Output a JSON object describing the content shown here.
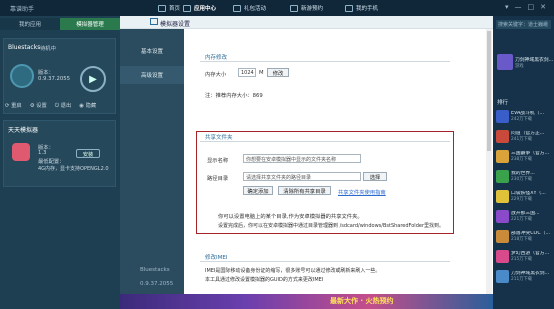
{
  "window": {
    "title": "靠谱助手"
  },
  "nav": [
    {
      "label": "首页"
    },
    {
      "label": "应用中心"
    },
    {
      "label": "礼包活动"
    },
    {
      "label": "新游预约"
    },
    {
      "label": "我的手机"
    }
  ],
  "window_controls": [
    "▾",
    "—",
    "□",
    "✕"
  ],
  "left_tabs": [
    {
      "label": "我的应用"
    },
    {
      "label": "模拟器管理"
    }
  ],
  "card1": {
    "name": "Bluestacks",
    "status": "待机中",
    "version_label": "版本：",
    "version": "0.9.37.2055",
    "actions": [
      "重启",
      "设置",
      "退出",
      "隐藏"
    ]
  },
  "card2": {
    "title": "天天模拟器",
    "version_label": "版本：",
    "version": "1.3",
    "req_label": "最低配置：",
    "req": "4G内存，显卡支持OPENGL2.0",
    "install": "安装"
  },
  "dialog": {
    "title": "模拟器设置",
    "side_items": [
      "基本设置",
      "高级设置"
    ],
    "bottom_name": "Bluestacks",
    "bottom_version": "0.9.37.2055"
  },
  "memory": {
    "section": "内存修改",
    "label": "内存大小",
    "value": "1024",
    "unit": "M",
    "button": "修改",
    "note": "注：推荐内存大小：869"
  },
  "shared": {
    "section": "共享文件夹",
    "display_label": "显示名称",
    "display_placeholder": "你想要在安卓模拟器中显示的文件夹名称",
    "path_label": "路径目录",
    "path_placeholder": "请选择共享文件夹的路径目录",
    "choose": "选择",
    "add": "确定添加",
    "clear": "清除所有共享目录",
    "link": "共享文件夹使用指南",
    "info1": "你可以设置电脑上的某个目录,作为安卓模拟器的共享文件夹。",
    "info2": "设置完成后，你可以在安卓模拟器中通过目录管理器到 /sdcard/windows/BstSharedFolder里找到。"
  },
  "imei": {
    "section": "修改IMEI",
    "line1": "IMEI是国际移动设备身份证的缩写，很多账号可以通过修改或刷新来刷入一些。",
    "line2": "本工具通过修改设置模拟器的GUID的方式来更改IMEI"
  },
  "right": {
    "search_placeholder": "搜索关键字：道士巍峨",
    "featured_title": "刀剑神域黑衣剑...",
    "featured_sub": "游戏",
    "rank_title": "排行",
    "games": [
      {
        "name": "EVA战斗机（...",
        "size": "242万下载",
        "color": "#3a5ec9"
      },
      {
        "name": "问道（官方正...",
        "size": "241万下载",
        "color": "#c94a3a"
      },
      {
        "name": "三国霸争（官方...",
        "size": "238万下载",
        "color": "#d9a33a"
      },
      {
        "name": "我的世界...",
        "size": "230万下载",
        "color": "#3aa24a"
      },
      {
        "name": "口袋妖怪XY（...",
        "size": "229万下载",
        "color": "#e0c23a"
      },
      {
        "name": "放开那三国...",
        "size": "221万下载",
        "color": "#8a4ac9"
      },
      {
        "name": "部落冲突COC（...",
        "size": "218万下载",
        "color": "#c98a3a"
      },
      {
        "name": "梦幻西游（官方...",
        "size": "215万下载",
        "color": "#d94a8a"
      },
      {
        "name": "刀剑神域黑衣剑...",
        "size": "211万下载",
        "color": "#4a8ac9"
      }
    ]
  },
  "banner": {
    "text": "最新大作 · 火热预约"
  }
}
